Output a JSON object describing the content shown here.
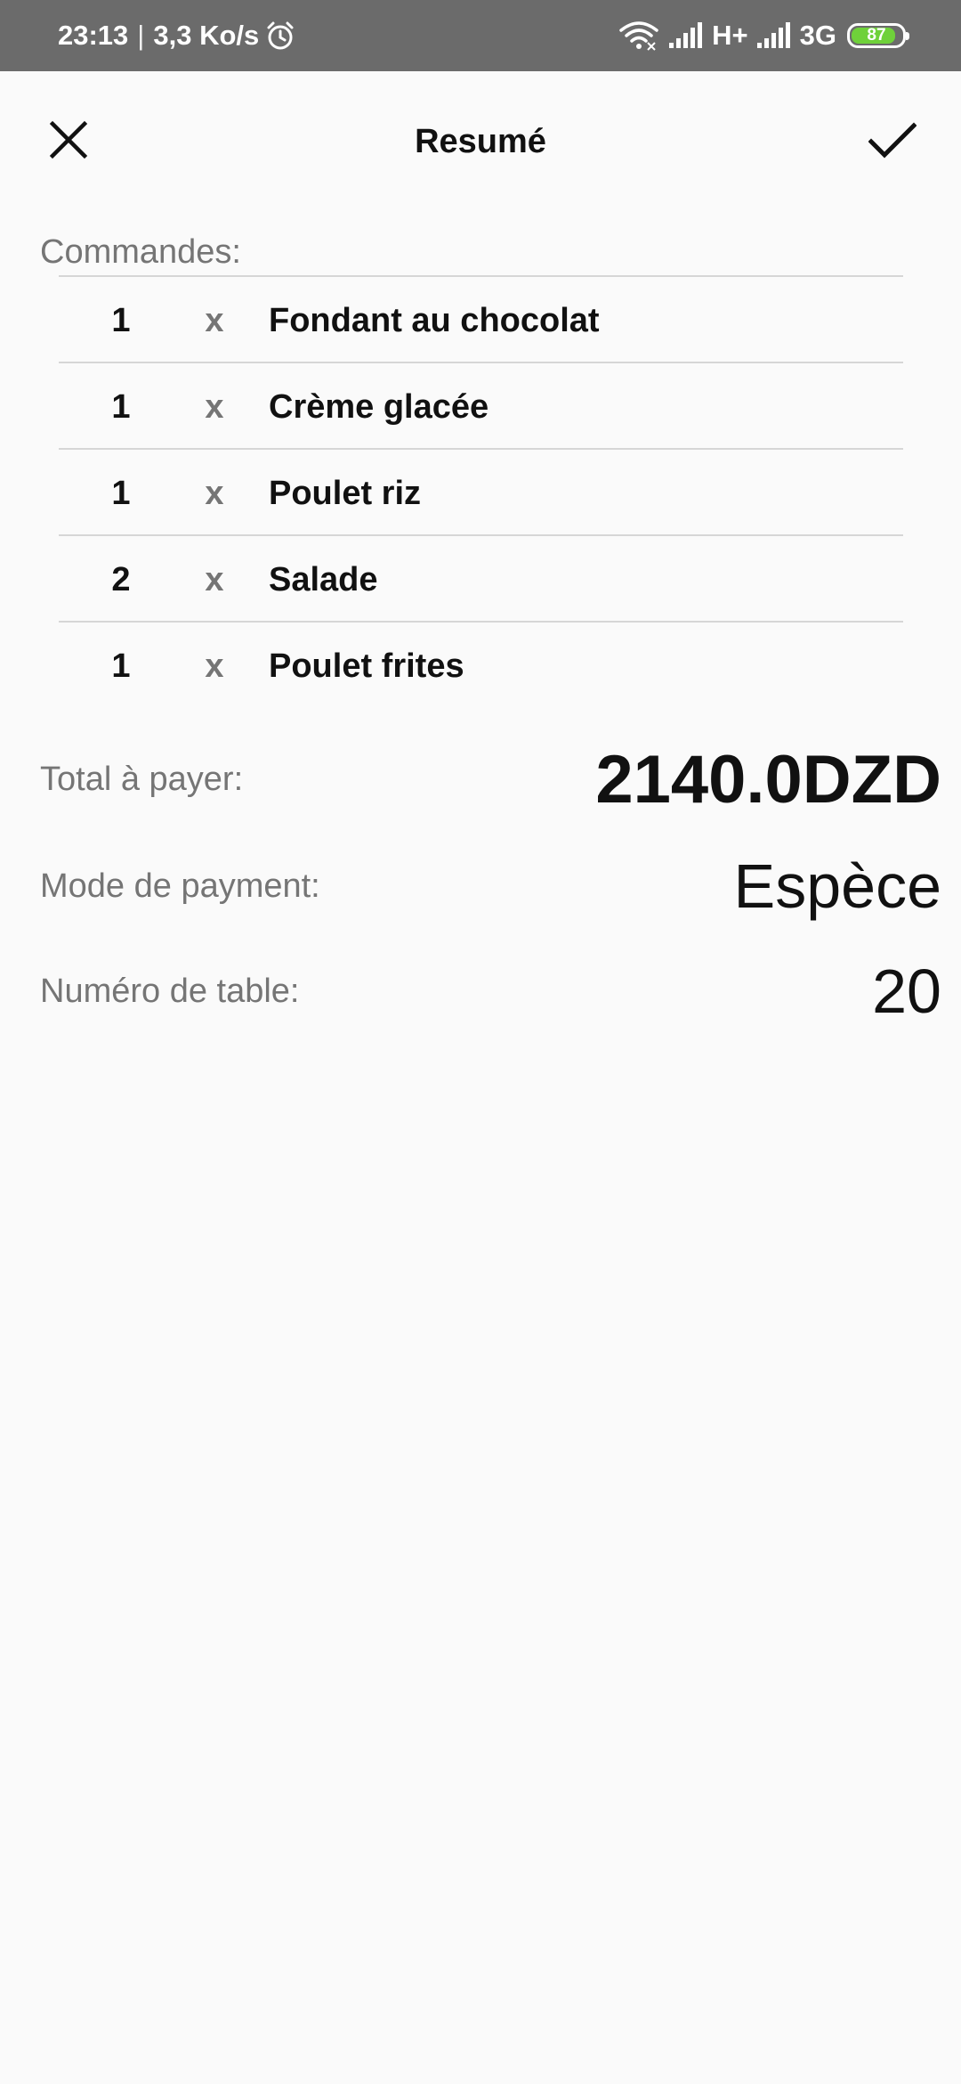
{
  "status_bar": {
    "time": "23:13",
    "separator": "|",
    "speed": "3,3 Ko/s",
    "alarm_icon": "alarm-clock-icon",
    "wifi_icon": "wifi-icon",
    "signal_icon": "signal-bars-icon",
    "network_1": "H+",
    "network_2": "3G",
    "battery_level": "87",
    "battery_color": "#6fd13a"
  },
  "toolbar": {
    "title": "Resumé",
    "close_icon": "close-icon",
    "confirm_icon": "check-icon"
  },
  "orders": {
    "label": "Commandes:",
    "items": [
      {
        "qty": "1",
        "x": "x",
        "name": "Fondant au chocolat"
      },
      {
        "qty": "1",
        "x": "x",
        "name": "Crème glacée"
      },
      {
        "qty": "1",
        "x": "x",
        "name": "Poulet riz"
      },
      {
        "qty": "2",
        "x": "x",
        "name": "Salade"
      },
      {
        "qty": "1",
        "x": "x",
        "name": "Poulet frites"
      }
    ]
  },
  "summary": {
    "total_label": "Total à payer:",
    "total_value": "2140.0DZD",
    "payment_label": "Mode de payment:",
    "payment_value": "Espèce",
    "table_label": "Numéro de table:",
    "table_value": "20"
  },
  "colors": {
    "background": "#fafafa",
    "status_bar": "#6b6b6b",
    "label_gray": "#757575",
    "text_dark": "#111111",
    "divider": "#d6d6d6"
  }
}
